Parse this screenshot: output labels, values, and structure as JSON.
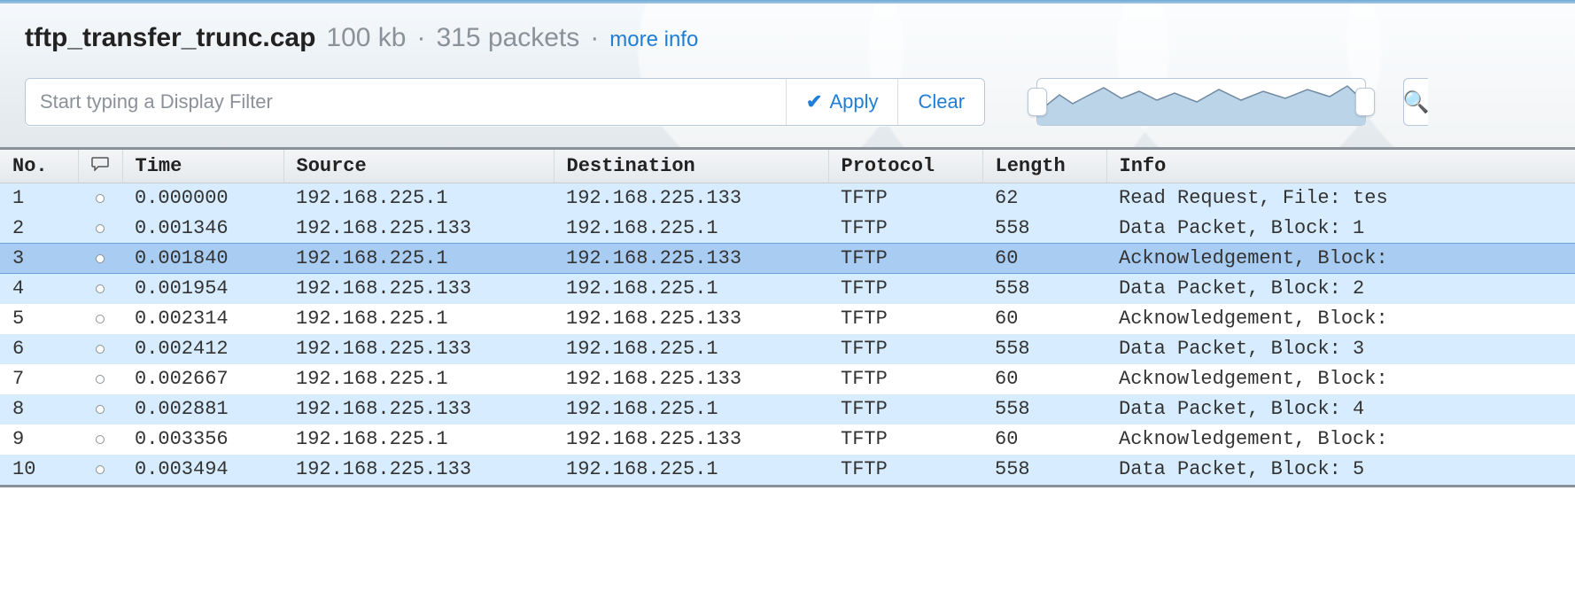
{
  "header": {
    "filename": "tftp_transfer_trunc.cap",
    "size_text": "100 kb",
    "separator": "·",
    "packet_count_text": "315 packets",
    "more_info_label": "more info"
  },
  "filter": {
    "placeholder": "Start typing a Display Filter",
    "value": "",
    "apply_label": "Apply",
    "clear_label": "Clear"
  },
  "columns": {
    "no": "No.",
    "comment": "",
    "time": "Time",
    "source": "Source",
    "destination": "Destination",
    "protocol": "Protocol",
    "length": "Length",
    "info": "Info"
  },
  "rows": [
    {
      "no": "1",
      "time": "0.000000",
      "src": "192.168.225.1",
      "dst": "192.168.225.133",
      "proto": "TFTP",
      "len": "62",
      "info": "Read Request, File: tes",
      "style": "tint"
    },
    {
      "no": "2",
      "time": "0.001346",
      "src": "192.168.225.133",
      "dst": "192.168.225.1",
      "proto": "TFTP",
      "len": "558",
      "info": "Data Packet, Block: 1",
      "style": "tint"
    },
    {
      "no": "3",
      "time": "0.001840",
      "src": "192.168.225.1",
      "dst": "192.168.225.133",
      "proto": "TFTP",
      "len": "60",
      "info": "Acknowledgement, Block:",
      "style": "sel"
    },
    {
      "no": "4",
      "time": "0.001954",
      "src": "192.168.225.133",
      "dst": "192.168.225.1",
      "proto": "TFTP",
      "len": "558",
      "info": "Data Packet, Block: 2",
      "style": "tint"
    },
    {
      "no": "5",
      "time": "0.002314",
      "src": "192.168.225.1",
      "dst": "192.168.225.133",
      "proto": "TFTP",
      "len": "60",
      "info": "Acknowledgement, Block:",
      "style": "plain"
    },
    {
      "no": "6",
      "time": "0.002412",
      "src": "192.168.225.133",
      "dst": "192.168.225.1",
      "proto": "TFTP",
      "len": "558",
      "info": "Data Packet, Block: 3",
      "style": "tint"
    },
    {
      "no": "7",
      "time": "0.002667",
      "src": "192.168.225.1",
      "dst": "192.168.225.133",
      "proto": "TFTP",
      "len": "60",
      "info": "Acknowledgement, Block:",
      "style": "plain"
    },
    {
      "no": "8",
      "time": "0.002881",
      "src": "192.168.225.133",
      "dst": "192.168.225.1",
      "proto": "TFTP",
      "len": "558",
      "info": "Data Packet, Block: 4",
      "style": "tint"
    },
    {
      "no": "9",
      "time": "0.003356",
      "src": "192.168.225.1",
      "dst": "192.168.225.133",
      "proto": "TFTP",
      "len": "60",
      "info": "Acknowledgement, Block:",
      "style": "plain"
    },
    {
      "no": "10",
      "time": "0.003494",
      "src": "192.168.225.133",
      "dst": "192.168.225.1",
      "proto": "TFTP",
      "len": "558",
      "info": "Data Packet, Block: 5",
      "style": "tint"
    }
  ]
}
